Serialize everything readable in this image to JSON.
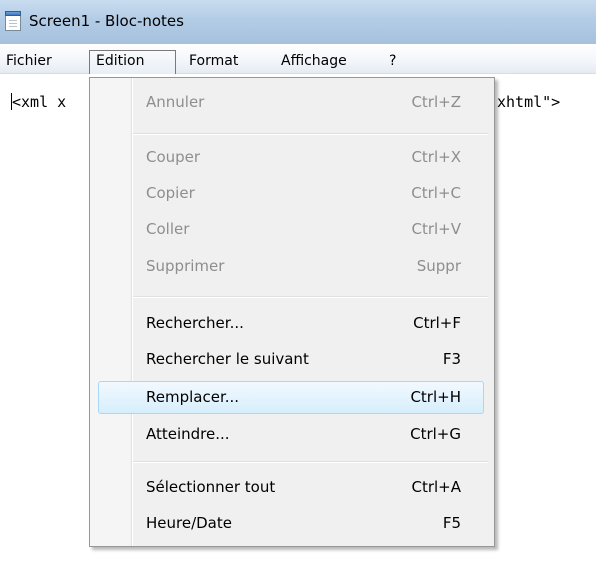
{
  "window": {
    "title": "Screen1 - Bloc-notes"
  },
  "menubar": [
    "Fichier",
    "Edition",
    "Format",
    "Affichage",
    "?"
  ],
  "editor": {
    "line_left": "<xml x",
    "line_right": "xhtml\">"
  },
  "edit_menu": [
    {
      "label": "Annuler",
      "shortcut": "Ctrl+Z",
      "enabled": false
    },
    {
      "label": "Couper",
      "shortcut": "Ctrl+X",
      "enabled": false
    },
    {
      "label": "Copier",
      "shortcut": "Ctrl+C",
      "enabled": false
    },
    {
      "label": "Coller",
      "shortcut": "Ctrl+V",
      "enabled": false
    },
    {
      "label": "Supprimer",
      "shortcut": "Suppr",
      "enabled": false
    },
    {
      "label": "Rechercher...",
      "shortcut": "Ctrl+F",
      "enabled": true
    },
    {
      "label": "Rechercher le suivant",
      "shortcut": "F3",
      "enabled": true
    },
    {
      "label": "Remplacer...",
      "shortcut": "Ctrl+H",
      "enabled": true,
      "highlighted": true
    },
    {
      "label": "Atteindre...",
      "shortcut": "Ctrl+G",
      "enabled": true
    },
    {
      "label": "Sélectionner tout",
      "shortcut": "Ctrl+A",
      "enabled": true
    },
    {
      "label": "Heure/Date",
      "shortcut": "F5",
      "enabled": true
    }
  ]
}
